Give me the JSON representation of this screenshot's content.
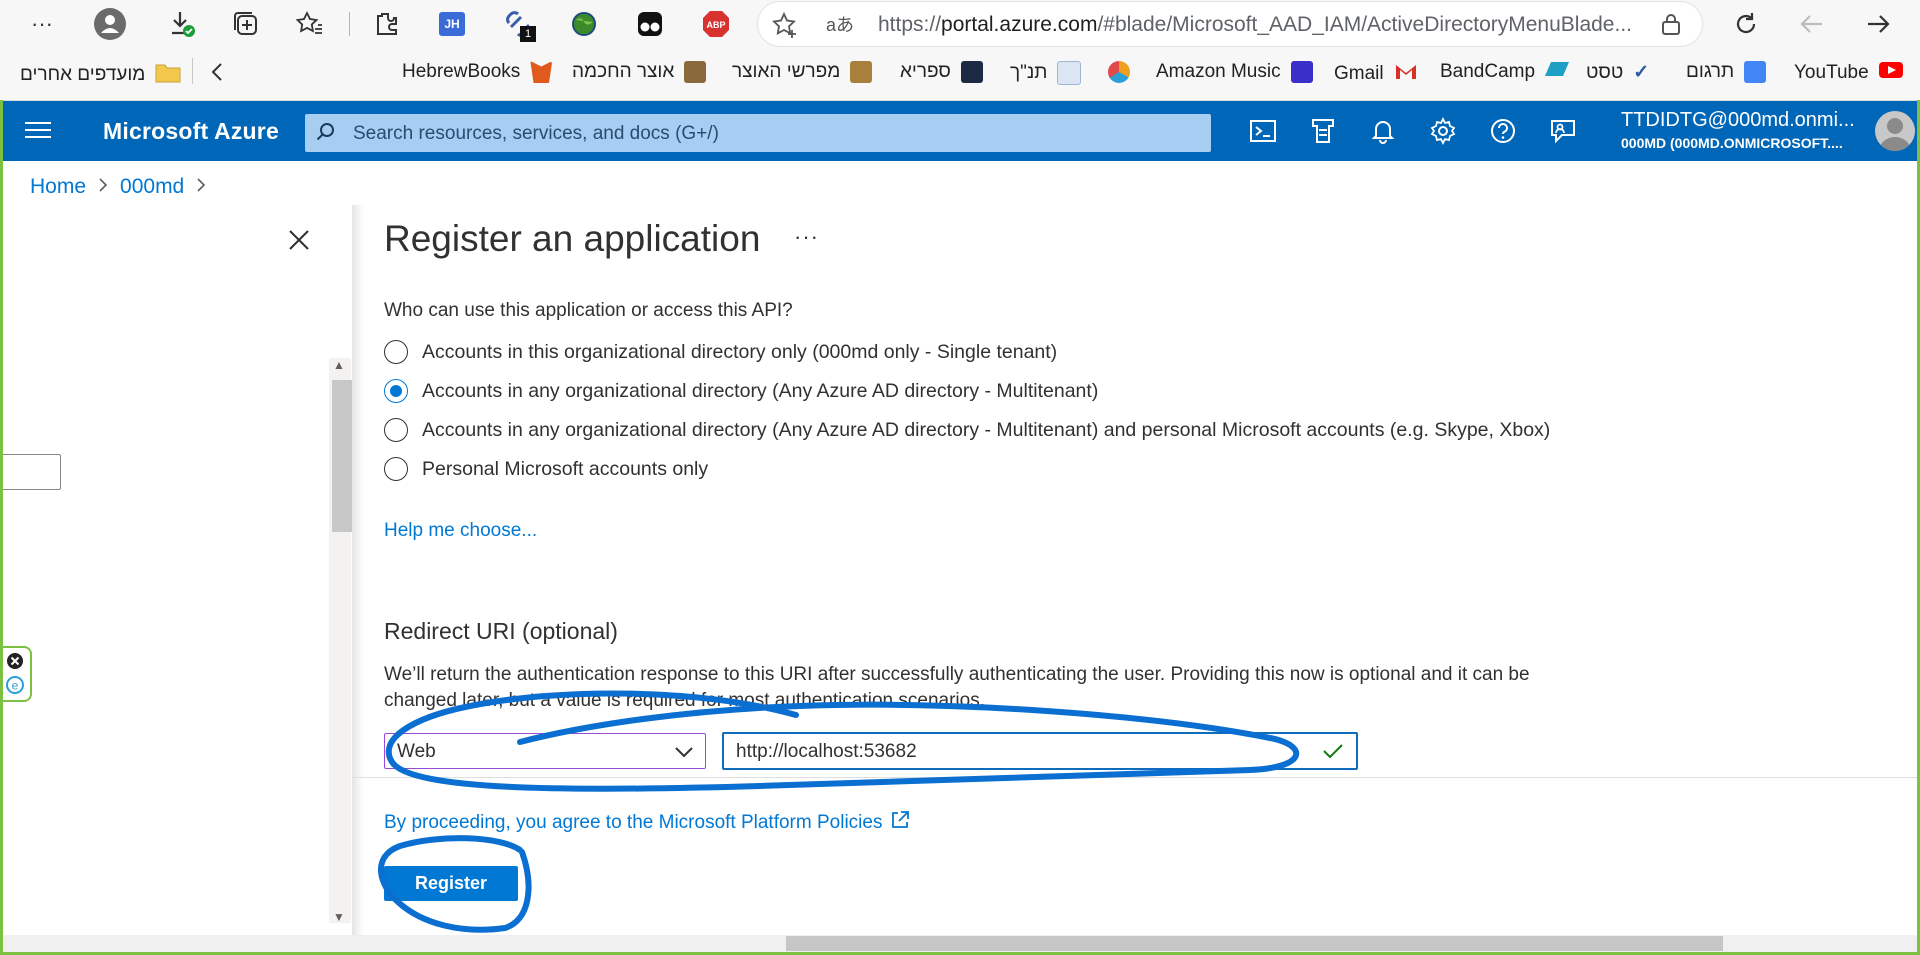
{
  "browser": {
    "more_label": "···",
    "url_prefix": "https://",
    "url_host": "portal.azure.com",
    "url_rest": "/#blade/Microsoft_AAD_IAM/ActiveDirectoryMenuBlade...",
    "download_badge": "1",
    "jh_label": "JH",
    "abp_label": "ABP",
    "translate_glyph": "aあ"
  },
  "bookmarks": {
    "other_favorites": "מועדפים אחרים",
    "items": [
      {
        "label": "HebrewBooks",
        "color": "#e05a1e"
      },
      {
        "label": "אוצר החכמה",
        "color": "#8a6a3a"
      },
      {
        "label": "מפרשי האוצר",
        "color": "#a8803c"
      },
      {
        "label": "ספריא",
        "color": "#1d2a44"
      },
      {
        "label": "תנ\"ך",
        "color": "#9db7d4"
      },
      {
        "label": "",
        "color": "#f0a020"
      },
      {
        "label": "Amazon Music",
        "color": "#3b2fc9"
      },
      {
        "label": "Gmail",
        "color": "#d93025"
      },
      {
        "label": "BandCamp",
        "color": "#1da0c3"
      },
      {
        "label": "טסט",
        "color": "#2b57a7"
      },
      {
        "label": "תרגום",
        "color": "#4285f4"
      },
      {
        "label": "YouTube",
        "color": "#ff0000"
      }
    ]
  },
  "azure": {
    "brand": "Microsoft Azure",
    "search_placeholder": "Search resources, services, and docs (G+/)",
    "account_name": "TTDIDTG@000md.onmi...",
    "account_dir": "000MD (000MD.ONMICROSOFT...."
  },
  "breadcrumb": {
    "home": "Home",
    "tenant": "000md",
    "sep": ">"
  },
  "blade": {
    "title": "Register an application",
    "more": "···",
    "question": "Who can use this application or access this API?",
    "options": [
      {
        "label": "Accounts in this organizational directory only (000md only - Single tenant)",
        "selected": false
      },
      {
        "label": "Accounts in any organizational directory (Any Azure AD directory - Multitenant)",
        "selected": true
      },
      {
        "label": "Accounts in any organizational directory (Any Azure AD directory - Multitenant) and personal Microsoft accounts (e.g. Skype, Xbox)",
        "selected": false
      },
      {
        "label": "Personal Microsoft accounts only",
        "selected": false
      }
    ],
    "help_link": "Help me choose...",
    "redirect_heading": "Redirect URI (optional)",
    "redirect_desc": "We’ll return the authentication response to this URI after successfully authenticating the user. Providing this now is optional and it can be changed later, but a value is required for most authentication scenarios.",
    "platform_value": "Web",
    "uri_value": "http://localhost:53682",
    "policy_link": "By proceeding, you agree to the Microsoft Platform Policies",
    "register_label": "Register"
  },
  "colors": {
    "azure_header": "#0066b8",
    "link": "#0078d4",
    "annotation": "#0a6fd0",
    "frame": "#7cc142"
  }
}
